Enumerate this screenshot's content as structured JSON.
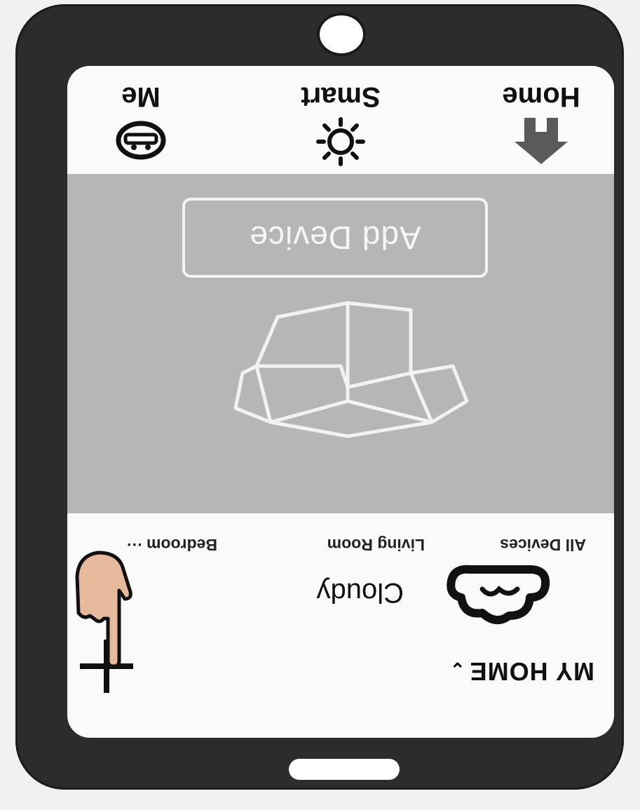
{
  "header": {
    "home_selector": "MY HOME",
    "weather": "Cloudy"
  },
  "room_tabs": [
    "All Devices",
    "Living Room",
    "Bedroom ···"
  ],
  "empty_state": {
    "add_device_label": "Add Device"
  },
  "bottom_nav": [
    {
      "label": "Home",
      "icon": "home-icon"
    },
    {
      "label": "Smart",
      "icon": "sun-icon"
    },
    {
      "label": "Me",
      "icon": "profile-icon"
    }
  ],
  "colors": {
    "phone_body": "#2e2b2b",
    "panel_grey": "#b6b6b4",
    "screen_bg": "#fafafa"
  }
}
